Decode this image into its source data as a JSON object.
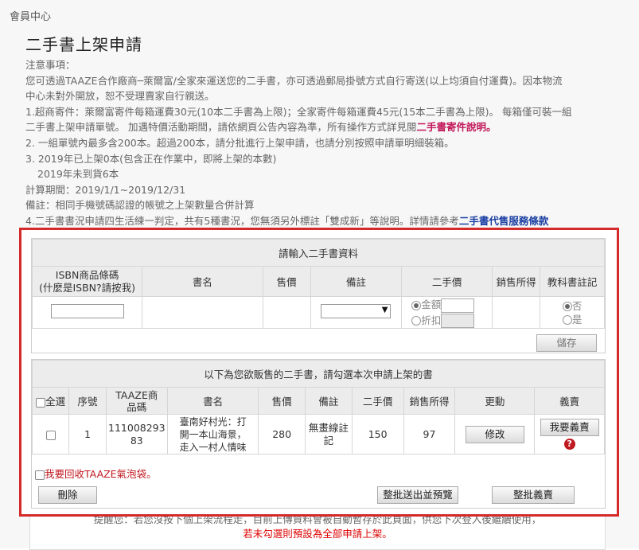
{
  "breadcrumb": "會員中心",
  "title": "二手書上架申請",
  "notes": {
    "heading": "注意事項：",
    "l1": "您可透過TAAZE合作廠商─萊爾富/全家來運送您的二手書，亦可透過郵局掛號方式自行寄送(以上均須自付運費)。因本物流",
    "l2": "中心未對外開放，恕不受理賣家自行親送。",
    "l3": "1.超商寄件：萊爾富寄件每箱運費30元(10本二手書為上限)；全家寄件每箱運費45元(15本二手書為上限)。 每箱僅可裝一組",
    "l4": "二手書上架申請單號。 加遇特價活動期間，請依網頁公告內容為準，所有操作方式詳見閱",
    "l4_link": "二手書寄件說明。",
    "l5": "2. 一組單號內最多含200本。超過200本，請分批進行上架申請，也請分別按照申請單明細裝箱。",
    "l6": "3. 2019年已上架0本(包含正在作業中，即將上架的本數)",
    "l7": "2019年未到貨6本",
    "l8": "計算期間：2019/1/1~2019/12/31",
    "l9": "備註：相同手機號碼認證的帳號之上架數量合併計算",
    "l10": "4.二手書書況申請四生活練一判定，共有5種書況，您無須另外標註「雙成新」等說明。詳情請參考",
    "l10_link": "二手書代售服務條款"
  },
  "input_panel": {
    "caption": "請輸入二手書資料",
    "headers": [
      "ISBN商品條碼\n(什麼是ISBN?請按我)",
      "書名",
      "售價",
      "備註",
      "二手價",
      "銷售所得",
      "教科書註記"
    ],
    "price_opt1": "金額",
    "price_opt2": "折扣",
    "tb_yes": "是",
    "tb_no": "否",
    "save": "儲存",
    "select_value": ""
  },
  "list_panel": {
    "caption": "以下為您欲販售的二手書，請勾選本次申請上架的書",
    "headers": [
      "全選",
      "序號",
      "TAAZE商品碼",
      "書名",
      "售價",
      "備註",
      "二手價",
      "銷售所得",
      "更動",
      "義賣"
    ],
    "rows": [
      {
        "seq": "1",
        "code": "11100829383",
        "code_a": "111008293",
        "code_b": "83",
        "title": "臺南好村光：打開一本山海景，走入一村人情味",
        "title_a": "臺南好村光：打",
        "title_b": "開一本山海景，",
        "title_c": "走入一村人情味",
        "price": "280",
        "remark_a": "無畫線註",
        "remark_b": "記",
        "used_price": "150",
        "income": "97",
        "edit": "修改",
        "charity": "我要義賣"
      }
    ],
    "recycle": "我要回收TAAZE氣泡袋。",
    "delete": "刪除",
    "submit": "整批送出並預覽",
    "charity_all": "整批義賣"
  },
  "footer": {
    "hint": "提醒您：若您沒按下個上架流程走，目前上傳資料會被自動暫存於此頁面，供您下次登入後繼續使用，",
    "warn": "若未勾選則預設為全部申請上架。"
  },
  "colors": {
    "highlight_border": "#d42a2a",
    "link_pink": "#c2185b",
    "warn_red": "#d00000"
  }
}
